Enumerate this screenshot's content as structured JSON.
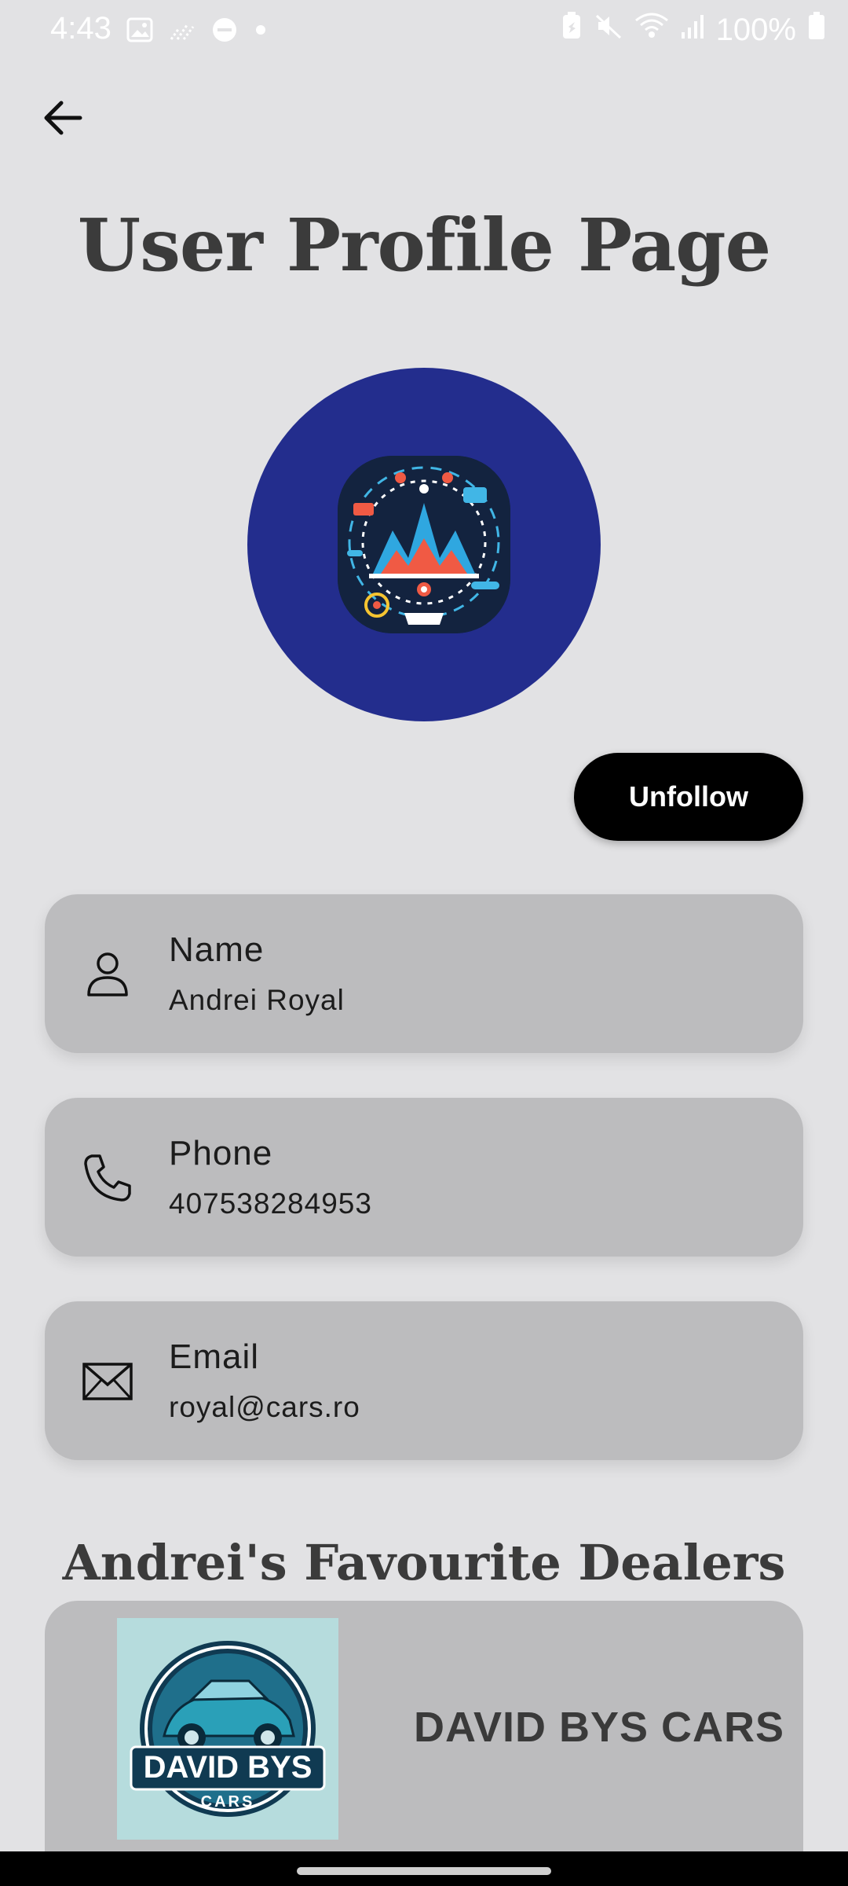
{
  "status_bar": {
    "time": "4:43",
    "battery": "100%",
    "left_icons": [
      "image-icon",
      "signal-dots-icon",
      "do-not-disturb-icon",
      "dot-icon"
    ],
    "right_icons": [
      "battery-saver-icon",
      "mute-icon",
      "wifi-icon",
      "cell-signal-icon",
      "battery-icon"
    ]
  },
  "header": {
    "back_icon": "arrow-left-icon",
    "title": "User Profile Page"
  },
  "profile": {
    "avatar_bg": "#232d8d",
    "follow_button_label": "Unfollow"
  },
  "details": [
    {
      "icon": "person-icon",
      "label": "Name",
      "value": "Andrei Royal"
    },
    {
      "icon": "phone-icon",
      "label": "Phone",
      "value": "407538284953"
    },
    {
      "icon": "mail-icon",
      "label": "Email",
      "value": "royal@cars.ro"
    }
  ],
  "dealers_section": {
    "title": "Andrei's Favourite Dealers",
    "dealers": [
      {
        "name": "DAVID BYS CARS",
        "logo_text_main": "DAVID BYS",
        "logo_text_sub": "CARS"
      }
    ]
  },
  "colors": {
    "background": "#e2e2e4",
    "card": "#bcbcbe",
    "button": "#000000",
    "title": "#3b3b3b"
  }
}
